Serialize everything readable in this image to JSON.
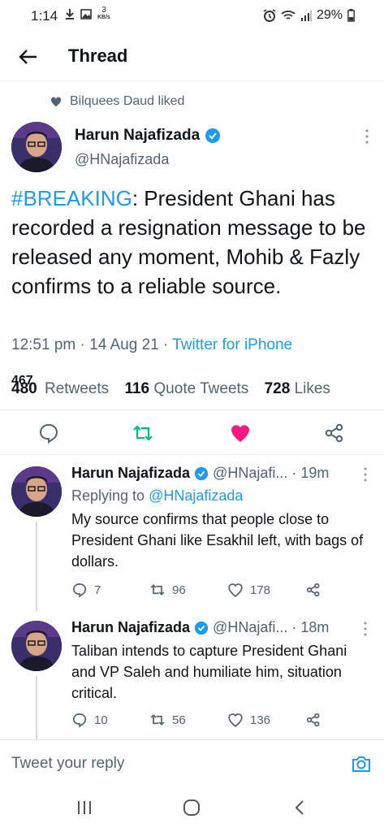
{
  "status_bar": {
    "time": "1:14",
    "net_speed_top": "3",
    "net_speed_unit": "KB/s",
    "battery": "29%"
  },
  "header": {
    "title": "Thread"
  },
  "social_context": "Bilquees Daud liked",
  "main_tweet": {
    "name": "Harun Najafizada",
    "handle": "@HNajafizada",
    "hashtag": "#BREAKING",
    "text": ": President Ghani has recorded a resignation message to be released any moment, Mohib & Fazly confirms to a reliable source.",
    "time": "12:51 pm",
    "date": "14 Aug 21",
    "source": "Twitter for iPhone",
    "retweets_previous": "467",
    "retweets": "480",
    "retweets_label": "Retweets",
    "quote_tweets": "116",
    "quote_tweets_label": "Quote Tweets",
    "likes": "728",
    "likes_label": "Likes",
    "colors": {
      "retweet_active": "#00ba7c",
      "like_active": "#f91880",
      "link": "#1d9bf0"
    }
  },
  "replies": [
    {
      "name": "Harun Najafizada",
      "handle": "@HNajafi...",
      "age": "19m",
      "replying_prefix": "Replying to",
      "replying_to": "@HNajafizada",
      "text": "My source confirms that people close to President Ghani like Esakhil left, with bags of dollars.",
      "reply_count": "7",
      "retweet_count": "96",
      "like_count": "178"
    },
    {
      "name": "Harun Najafizada",
      "handle": "@HNajafi...",
      "age": "18m",
      "text": "Taliban intends to capture President Ghani and VP Saleh and humiliate him, situation critical.",
      "reply_count": "10",
      "retweet_count": "56",
      "like_count": "136"
    }
  ],
  "reply_bar": {
    "placeholder": "Tweet your reply"
  }
}
